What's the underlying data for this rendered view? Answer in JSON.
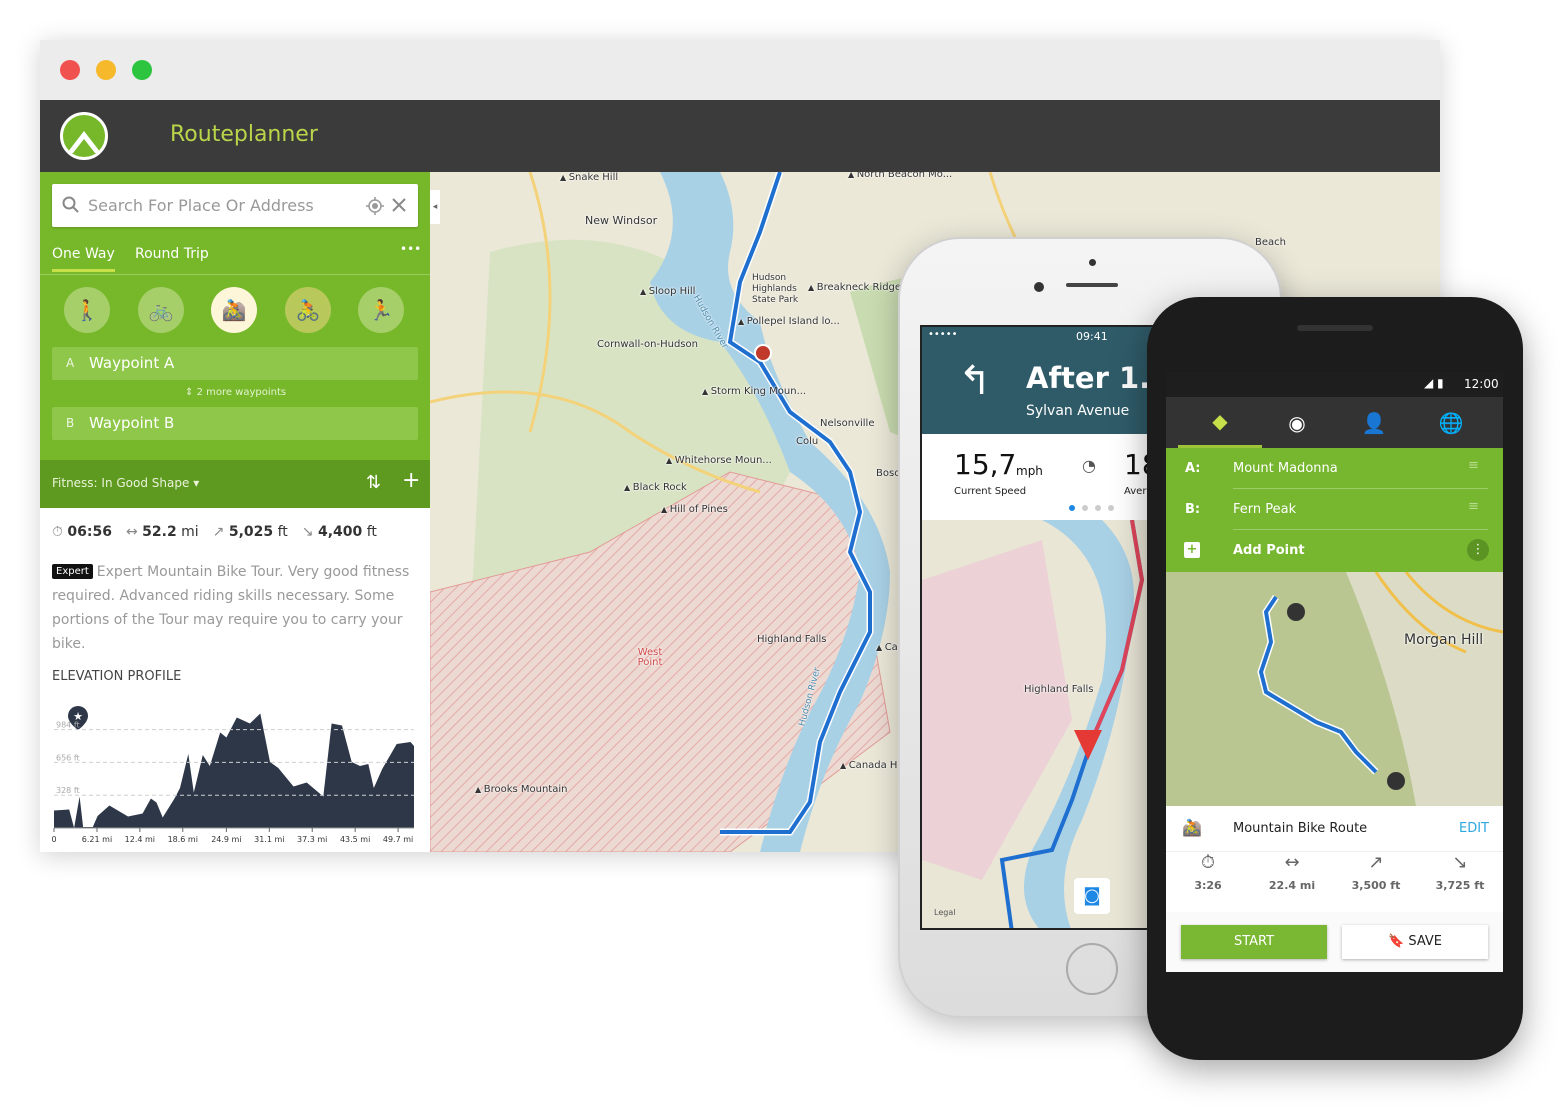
{
  "app": {
    "title": "Routeplanner",
    "accent": "#76b82a",
    "header_bg": "#3b3b3b"
  },
  "search": {
    "placeholder": "Search For Place Or Address",
    "icons": [
      "search-icon",
      "locate-icon",
      "close-icon"
    ]
  },
  "tabs": [
    {
      "label": "One Way",
      "active": true
    },
    {
      "label": "Round Trip",
      "active": false
    }
  ],
  "more_label": "•••",
  "sport_modes": [
    {
      "name": "hiking",
      "icon": "🚶"
    },
    {
      "name": "touring-bike",
      "icon": "🚲"
    },
    {
      "name": "mountain-bike",
      "icon": "🚵",
      "selected": true
    },
    {
      "name": "road-bike",
      "icon": "🚴"
    },
    {
      "name": "running",
      "icon": "🏃"
    }
  ],
  "waypoints": {
    "a": {
      "letter": "A",
      "name": "Waypoint A"
    },
    "more": "2 more waypoints",
    "b": {
      "letter": "B",
      "name": "Waypoint B"
    }
  },
  "fitness": {
    "label": "Fitness: In Good Shape"
  },
  "route_stats": {
    "duration": "06:56",
    "distance_value": "52.2",
    "distance_unit": "mi",
    "uphill_value": "5,025",
    "uphill_unit": "ft",
    "downhill_value": "4,400",
    "downhill_unit": "ft"
  },
  "difficulty": {
    "badge": "Expert",
    "description": "Expert Mountain Bike Tour. Very good fitness required. Advanced riding skills necessary. Some portions of the Tour may require you to carry your bike."
  },
  "elevation": {
    "title": "ELEVATION PROFILE"
  },
  "chart_data": {
    "type": "area",
    "title": "ELEVATION PROFILE",
    "xlabel": "",
    "ylabel": "",
    "x_unit": "mi",
    "y_unit": "ft",
    "xlim": [
      0,
      52
    ],
    "ylim": [
      0,
      1200
    ],
    "grid": "horizontal-dashed",
    "x_ticks": [
      "0",
      "6.21 mi",
      "12.4 mi",
      "18.6 mi",
      "24.9 mi",
      "31.1 mi",
      "37.3 mi",
      "43.5 mi",
      "49.7 mi"
    ],
    "x_tick_values": [
      0,
      6.21,
      12.4,
      18.6,
      24.9,
      31.1,
      37.3,
      43.5,
      49.7
    ],
    "y_ticks": [
      "328 ft",
      "656 ft",
      "984 ft"
    ],
    "y_tick_values": [
      328,
      656,
      984
    ],
    "color": "#2d3748",
    "points": [
      [
        0,
        175
      ],
      [
        2.2,
        185
      ],
      [
        2.9,
        0
      ],
      [
        3.7,
        315
      ],
      [
        4.2,
        10
      ],
      [
        5.6,
        10
      ],
      [
        6.3,
        120
      ],
      [
        8.0,
        225
      ],
      [
        10.7,
        115
      ],
      [
        12.8,
        145
      ],
      [
        14.0,
        295
      ],
      [
        14.8,
        255
      ],
      [
        15.7,
        105
      ],
      [
        17.4,
        295
      ],
      [
        18.2,
        400
      ],
      [
        19.4,
        740
      ],
      [
        20.2,
        355
      ],
      [
        21.5,
        730
      ],
      [
        22.5,
        620
      ],
      [
        24.0,
        955
      ],
      [
        24.9,
        905
      ],
      [
        26.4,
        1105
      ],
      [
        28.3,
        1045
      ],
      [
        29.8,
        1145
      ],
      [
        31.2,
        660
      ],
      [
        32.4,
        600
      ],
      [
        34.6,
        415
      ],
      [
        36.5,
        455
      ],
      [
        38.9,
        315
      ],
      [
        40.1,
        1045
      ],
      [
        41.6,
        1025
      ],
      [
        43.0,
        660
      ],
      [
        44.2,
        620
      ],
      [
        45.4,
        640
      ],
      [
        46.2,
        400
      ],
      [
        47.4,
        590
      ],
      [
        49.5,
        840
      ],
      [
        51.5,
        860
      ],
      [
        52.0,
        820
      ]
    ]
  },
  "map": {
    "labels": [
      "Snake Hill",
      "North Beacon Mo...",
      "New Windsor",
      "Beach",
      "Sloop Hill",
      "Hudson Highlands State Park",
      "Breakneck Ridge",
      "Pollepel Island lo...",
      "Cornwall-on-Hudson",
      "Storm King Moun...",
      "Nelsonville",
      "Colu",
      "Bosc",
      "Whitehorse Moun...",
      "Black Rock",
      "Hill of Pines",
      "Highland Falls",
      "West Point",
      "Brooks Mountain",
      "Canada H",
      "Ca",
      "Hudson River",
      "Hudson River"
    ]
  },
  "iphone": {
    "signal": "•••••",
    "time": "09:41",
    "instruction": "After 1.5",
    "street": "Sylvan Avenue",
    "speed_value": "15,7",
    "speed_unit": "mph",
    "speed_label": "Current Speed",
    "avg_value": "18",
    "avg_label": "Avera",
    "map_label": "Highland Falls",
    "legal": "Legal"
  },
  "android": {
    "time": "12:00",
    "tabs": [
      "route-icon",
      "record-icon",
      "profile-icon",
      "globe-icon"
    ],
    "points": [
      {
        "letter": "A:",
        "name": "Mount Madonna"
      },
      {
        "letter": "B:",
        "name": "Fern Peak"
      }
    ],
    "add_point": "Add Point",
    "map_label": "Morgan Hill",
    "route_name": "Mountain Bike Route",
    "edit": "EDIT",
    "stats": [
      {
        "icon": "⏱",
        "value": "3:26"
      },
      {
        "icon": "↔",
        "value": "22.4 mi"
      },
      {
        "icon": "↗",
        "value": "3,500 ft"
      },
      {
        "icon": "↘",
        "value": "3,725 ft"
      }
    ],
    "start": "START",
    "save": "SAVE"
  }
}
